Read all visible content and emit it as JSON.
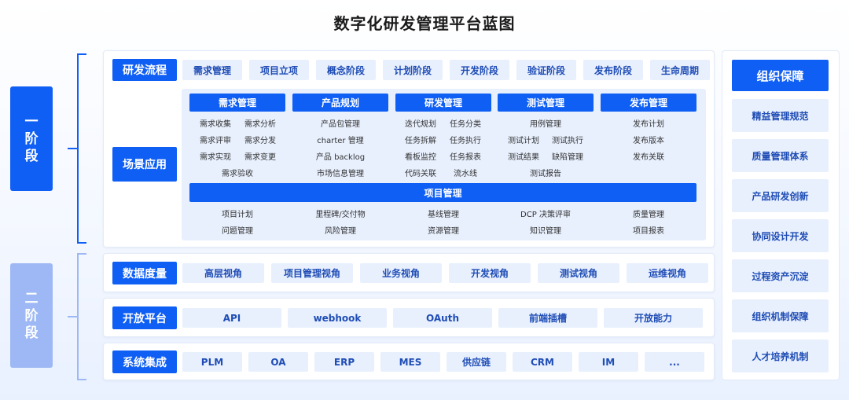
{
  "title": "数字化研发管理平台蓝图",
  "phases": {
    "one": [
      "一",
      "阶",
      "段"
    ],
    "two": [
      "二",
      "阶",
      "段"
    ]
  },
  "rd_process": {
    "label": "研发流程",
    "items": [
      "需求管理",
      "项目立项",
      "概念阶段",
      "计划阶段",
      "开发阶段",
      "验证阶段",
      "发布阶段",
      "生命周期"
    ]
  },
  "scenario": {
    "label": "场景应用",
    "columns": [
      {
        "title": "需求管理",
        "items": [
          "需求收集",
          "需求分析",
          "需求评审",
          "需求分发",
          "需求实现",
          "需求变更",
          "需求验收"
        ]
      },
      {
        "title": "产品规划",
        "items": [
          "产品包管理",
          "charter 管理",
          "产品 backlog",
          "市场信息管理"
        ]
      },
      {
        "title": "研发管理",
        "items": [
          "迭代规划",
          "任务分类",
          "任务拆解",
          "任务执行",
          "看板监控",
          "任务报表",
          "代码关联",
          "流水线"
        ]
      },
      {
        "title": "测试管理",
        "items": [
          "用例管理",
          "测试计划",
          "测试执行",
          "测试结果",
          "缺陷管理",
          "测试报告"
        ]
      },
      {
        "title": "发布管理",
        "items": [
          "发布计划",
          "发布版本",
          "发布关联"
        ]
      }
    ],
    "project_mgmt": {
      "title": "项目管理",
      "items": [
        "项目计划",
        "里程碑/交付物",
        "基线管理",
        "DCP 决策评审",
        "质量管理",
        "问题管理",
        "风险管理",
        "资源管理",
        "知识管理",
        "项目报表"
      ]
    }
  },
  "data_metrics": {
    "label": "数据度量",
    "items": [
      "高层视角",
      "项目管理视角",
      "业务视角",
      "开发视角",
      "测试视角",
      "运维视角"
    ]
  },
  "open_platform": {
    "label": "开放平台",
    "items": [
      "API",
      "webhook",
      "OAuth",
      "前端插槽",
      "开放能力"
    ]
  },
  "system_integration": {
    "label": "系统集成",
    "items": [
      "PLM",
      "OA",
      "ERP",
      "MES",
      "供应链",
      "CRM",
      "IM",
      "..."
    ]
  },
  "org_support": {
    "label": "组织保障",
    "items": [
      "精益管理规范",
      "质量管理体系",
      "产品研发创新",
      "协同设计开发",
      "过程资产沉淀",
      "组织机制保障",
      "人才培养机制"
    ]
  },
  "colors": {
    "primary": "#0f5ff5",
    "light": "#e8f0fe",
    "phase2": "#9db8f4",
    "chip_text": "#1f4db5"
  }
}
